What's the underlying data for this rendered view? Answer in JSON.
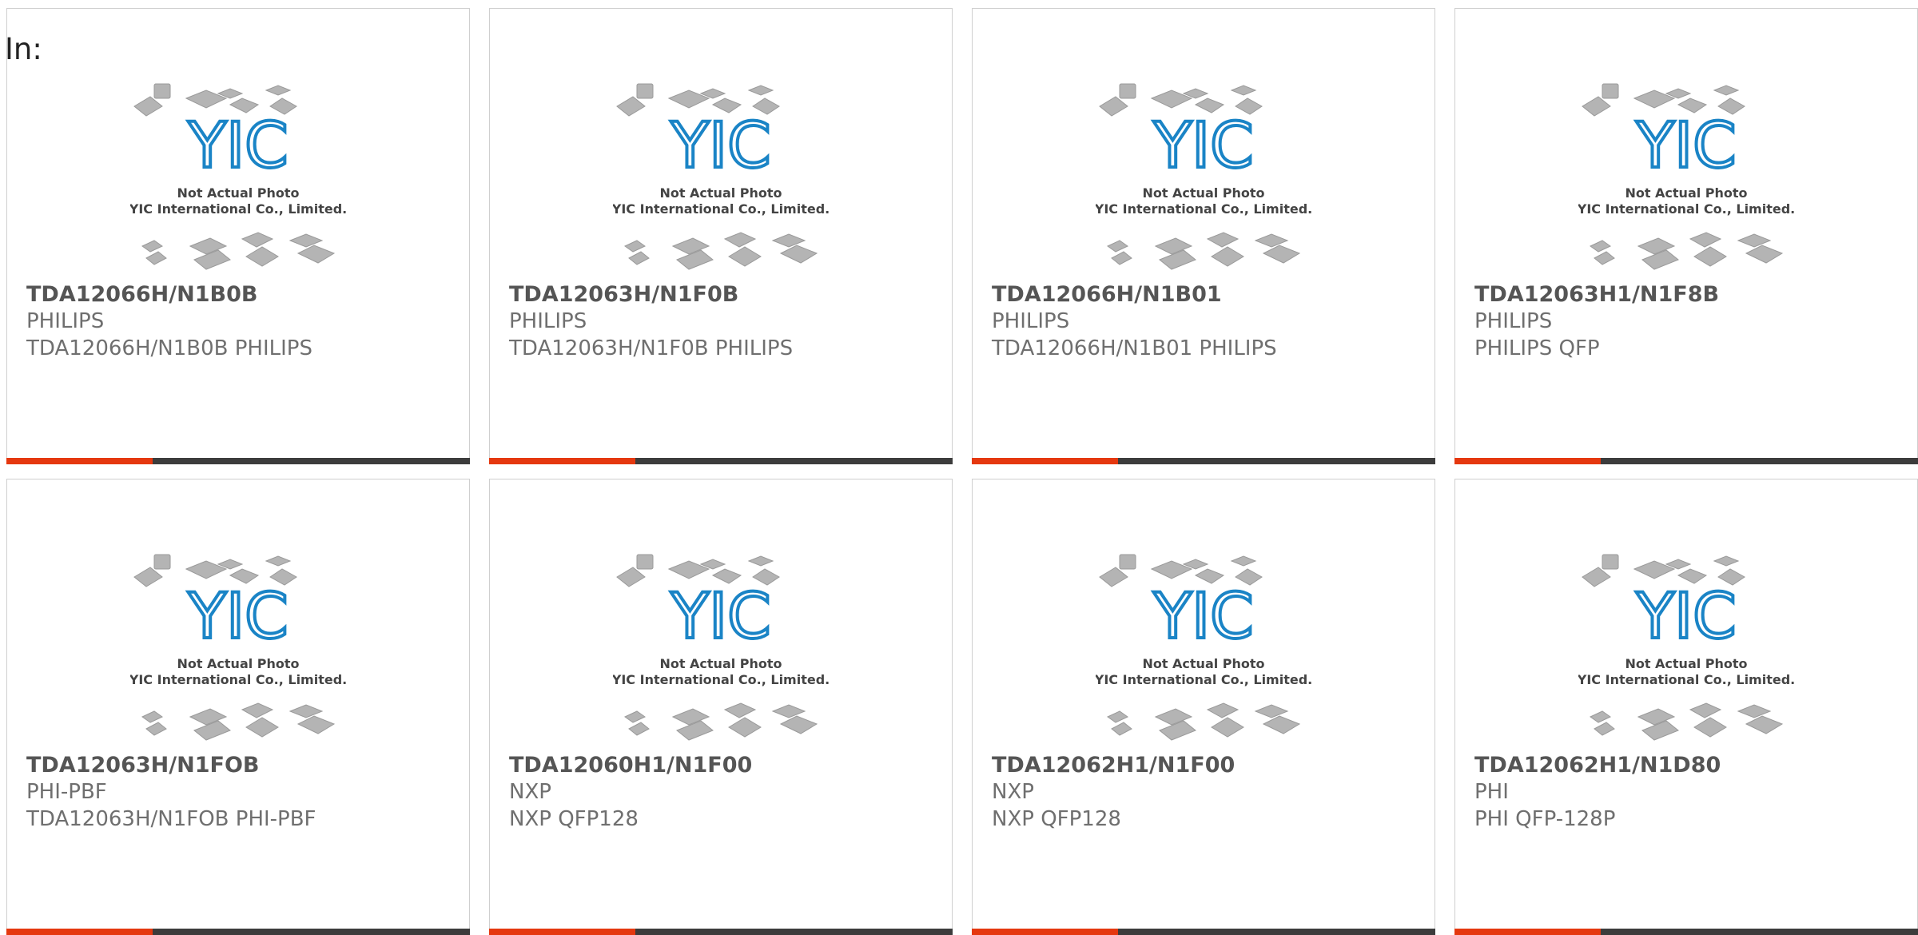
{
  "prefix_label": "In:",
  "photo": {
    "line1": "Not Actual Photo",
    "line2": "YIC International Co., Limited.",
    "logo_text": "YIC"
  },
  "colors": {
    "accent": "#e5380f",
    "bar": "#3c3c3c",
    "logo_blue": "#1a84c6"
  },
  "products": [
    {
      "part": "TDA12066H/N1B0B",
      "manufacturer": "PHILIPS",
      "description": "TDA12066H/N1B0B PHILIPS"
    },
    {
      "part": "TDA12063H/N1F0B",
      "manufacturer": "PHILIPS",
      "description": "TDA12063H/N1F0B PHILIPS"
    },
    {
      "part": "TDA12066H/N1B01",
      "manufacturer": "PHILIPS",
      "description": "TDA12066H/N1B01 PHILIPS"
    },
    {
      "part": "TDA12063H1/N1F8B",
      "manufacturer": "PHILIPS",
      "description": "PHILIPS QFP"
    },
    {
      "part": "TDA12063H/N1FOB",
      "manufacturer": "PHI-PBF",
      "description": "TDA12063H/N1FOB PHI-PBF"
    },
    {
      "part": "TDA12060H1/N1F00",
      "manufacturer": "NXP",
      "description": "NXP QFP128"
    },
    {
      "part": "TDA12062H1/N1F00",
      "manufacturer": "NXP",
      "description": "NXP QFP128"
    },
    {
      "part": "TDA12062H1/N1D80",
      "manufacturer": "PHI",
      "description": "PHI QFP-128P"
    }
  ]
}
